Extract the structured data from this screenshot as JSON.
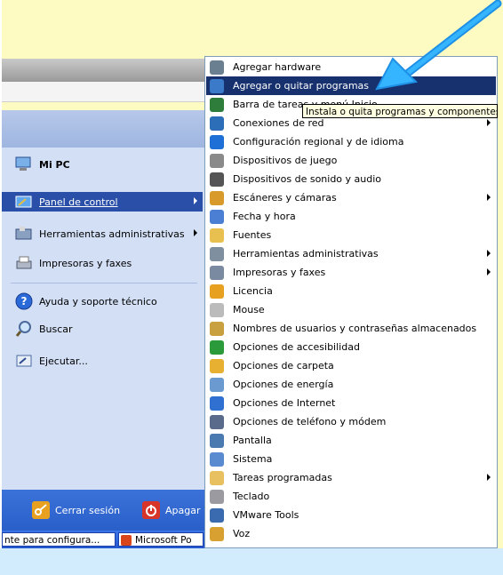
{
  "left_menu": {
    "mi_pc": "Mi PC",
    "panel_de_control": "Panel de control",
    "herramientas": "Herramientas administrativas",
    "impresoras": "Impresoras y faxes",
    "ayuda": "Ayuda y soporte técnico",
    "buscar": "Buscar",
    "ejecutar": "Ejecutar..."
  },
  "bottom_bar": {
    "cerrar_sesion": "Cerrar sesión",
    "apagar": "Apagar"
  },
  "taskbar": {
    "task1": "nte para configura...",
    "task2": "Microsoft Po"
  },
  "tooltip": "Instala o quita programas y componentes",
  "submenu": {
    "items": [
      {
        "label": "Agregar hardware",
        "icon": "hardware-icon",
        "color": "#6a7f8f"
      },
      {
        "label": "Agregar o quitar programas",
        "icon": "add-remove-programs-icon",
        "color": "#3a7ac8"
      },
      {
        "label": "Barra de tareas y menú Inicio",
        "icon": "taskbar-icon",
        "color": "#2e7d3a"
      },
      {
        "label": "Conexiones de red",
        "icon": "network-icon",
        "color": "#2c6fb8"
      },
      {
        "label": "Configuración regional y de idioma",
        "icon": "globe-icon",
        "color": "#1e6fd6"
      },
      {
        "label": "Dispositivos de juego",
        "icon": "gamepad-icon",
        "color": "#8a8a8a"
      },
      {
        "label": "Dispositivos de sonido y audio",
        "icon": "speaker-icon",
        "color": "#555555"
      },
      {
        "label": "Escáneres y cámaras",
        "icon": "scanner-icon",
        "color": "#d89a2a"
      },
      {
        "label": "Fecha y hora",
        "icon": "clock-icon",
        "color": "#4a7fd4"
      },
      {
        "label": "Fuentes",
        "icon": "fonts-folder-icon",
        "color": "#e8c050"
      },
      {
        "label": "Herramientas administrativas",
        "icon": "admin-tools-icon",
        "color": "#7f8f9f"
      },
      {
        "label": "Impresoras y faxes",
        "icon": "printer-icon",
        "color": "#7a8aa0"
      },
      {
        "label": "Licencia",
        "icon": "license-icon",
        "color": "#e8a020"
      },
      {
        "label": "Mouse",
        "icon": "mouse-icon",
        "color": "#bbbbbb"
      },
      {
        "label": "Nombres de usuarios y contraseñas almacenados",
        "icon": "users-icon",
        "color": "#c8a040"
      },
      {
        "label": "Opciones de accesibilidad",
        "icon": "accessibility-icon",
        "color": "#2a9a3a"
      },
      {
        "label": "Opciones de carpeta",
        "icon": "folder-options-icon",
        "color": "#e8b030"
      },
      {
        "label": "Opciones de energía",
        "icon": "power-icon",
        "color": "#6a9ad0"
      },
      {
        "label": "Opciones de Internet",
        "icon": "internet-icon",
        "color": "#3070d0"
      },
      {
        "label": "Opciones de teléfono y módem",
        "icon": "phone-icon",
        "color": "#5a6a8a"
      },
      {
        "label": "Pantalla",
        "icon": "display-icon",
        "color": "#4a7ab0"
      },
      {
        "label": "Sistema",
        "icon": "system-icon",
        "color": "#5a8ad0"
      },
      {
        "label": "Tareas programadas",
        "icon": "scheduled-tasks-icon",
        "color": "#e8c060"
      },
      {
        "label": "Teclado",
        "icon": "keyboard-icon",
        "color": "#9a9aa0"
      },
      {
        "label": "VMware Tools",
        "icon": "vmware-icon",
        "color": "#3a6ab0"
      },
      {
        "label": "Voz",
        "icon": "voice-icon",
        "color": "#d8a030"
      }
    ]
  }
}
